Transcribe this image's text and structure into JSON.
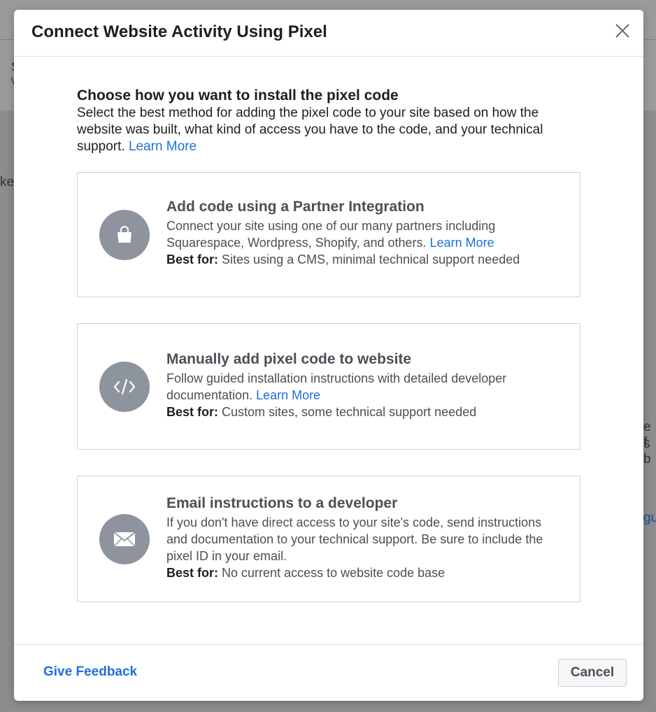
{
  "background": {
    "fragments": [
      "S",
      "W",
      "ke",
      "e f",
      "s b",
      "gu"
    ]
  },
  "modal": {
    "title": "Connect Website Activity Using Pixel",
    "close_icon": "close-icon"
  },
  "intro": {
    "title": "Choose how you want to install the pixel code",
    "description": "Select the best method for adding the pixel code to your site based on how the website was built, what kind of access you have to the code, and your technical support.",
    "learn_more": "Learn More"
  },
  "options": [
    {
      "icon": "shopping-bag-icon",
      "title": "Add code using a Partner Integration",
      "description": "Connect your site using one of our many partners including Squarespace, Wordpress, Shopify, and others.",
      "learn_more": "Learn More",
      "best_label": "Best for:",
      "best_text": "Sites using a CMS, minimal technical support needed"
    },
    {
      "icon": "code-icon",
      "title": "Manually add pixel code to website",
      "description": "Follow guided installation instructions with detailed developer documentation.",
      "learn_more": "Learn More",
      "best_label": "Best for:",
      "best_text": "Custom sites, some technical support needed"
    },
    {
      "icon": "envelope-icon",
      "title": "Email instructions to a developer",
      "description": "If you don't have direct access to your site's code, send instructions and documentation to your technical support. Be sure to include the pixel ID in your email.",
      "best_label": "Best for:",
      "best_text": "No current access to website code base"
    }
  ],
  "footer": {
    "feedback": "Give Feedback",
    "cancel": "Cancel"
  },
  "colors": {
    "link": "#216fdb",
    "icon_circle": "#8d949e",
    "overlay": "#8c8d8f"
  }
}
